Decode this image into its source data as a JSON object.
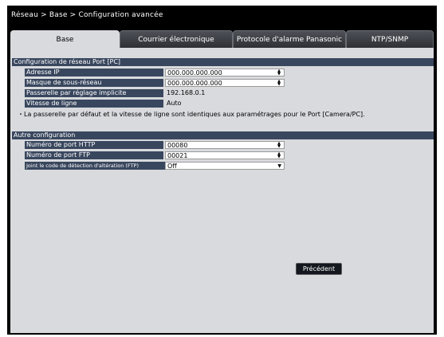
{
  "breadcrumb": "Réseau > Base > Configuration avancée",
  "tabs": [
    {
      "label": "Base",
      "active": true
    },
    {
      "label": "Courrier électronique",
      "active": false
    },
    {
      "label": "Protocole d'alarme Panasonic",
      "active": false
    },
    {
      "label": "NTP/SNMP",
      "active": false
    }
  ],
  "network_section": {
    "title": "Configuration de réseau Port [PC]",
    "rows": [
      {
        "label": "Adresse IP",
        "value": "000.000.000.000",
        "control": "spin"
      },
      {
        "label": "Masque de sous-réseau",
        "value": "000.000.000.000",
        "control": "spin"
      },
      {
        "label": "Passerelle par réglage implicite",
        "value": "192.168.0.1",
        "control": "static"
      },
      {
        "label": "Vitesse de ligne",
        "value": "Auto",
        "control": "static"
      }
    ],
    "note": "・La passerelle par défaut et la vitesse de ligne sont identiques aux paramétrages pour le Port [Camera/PC]."
  },
  "other_section": {
    "title": "Autre configuration",
    "rows": [
      {
        "label": "Numéro de port HTTP",
        "value": "00080",
        "control": "spin"
      },
      {
        "label": "Numéro de port FTP",
        "value": "00021",
        "control": "spin"
      },
      {
        "label": "Joint le code de détection d'altération (FTP)",
        "value": "Off",
        "control": "dropdown"
      }
    ]
  },
  "back_button": "Précédent",
  "colors": {
    "window_bg": "#000000",
    "panel_bg": "#d8dadd",
    "header_bg": "#39475e",
    "active_tab_bg": "#d8dadd"
  }
}
